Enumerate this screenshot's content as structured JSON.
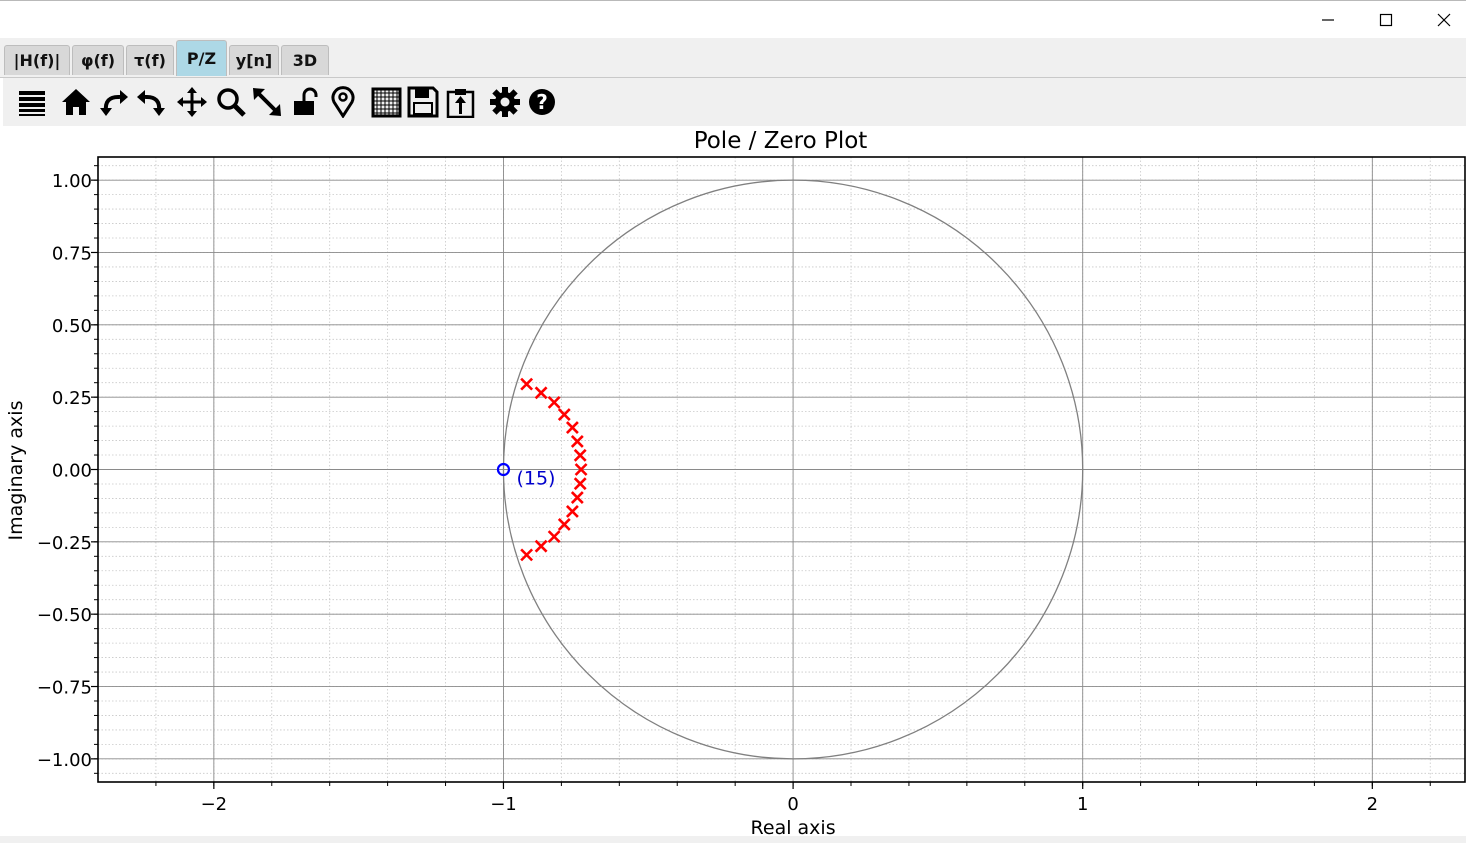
{
  "window": {
    "controls": [
      "minimize",
      "maximize",
      "close"
    ]
  },
  "tabs": [
    {
      "label": "|H(f)|",
      "active": false
    },
    {
      "label": "φ(f)",
      "active": false
    },
    {
      "label": "τ(f)",
      "active": false
    },
    {
      "label": "P/Z",
      "active": true
    },
    {
      "label": "y[n]",
      "active": false
    },
    {
      "label": "3D",
      "active": false
    }
  ],
  "toolbar": {
    "icons": [
      "menu-icon",
      "home-icon",
      "undo-icon",
      "redo-icon",
      "pan-icon",
      "zoom-icon",
      "autoscale-icon",
      "lock-icon",
      "marker-icon",
      "grid-icon",
      "save-icon",
      "clipboard-icon",
      "settings-icon",
      "help-icon"
    ]
  },
  "colors": {
    "active_tab": "#add8e6",
    "poles": "#ff0000",
    "zeros": "#0000ff",
    "unit_circle": "#808080"
  },
  "chart_data": {
    "type": "scatter",
    "title": "Pole / Zero Plot",
    "xlabel": "Real axis",
    "ylabel": "Imaginary axis",
    "xlim": [
      -2.4,
      2.32
    ],
    "ylim": [
      -1.08,
      1.08
    ],
    "xticks": [
      -2,
      -1,
      0,
      1,
      2
    ],
    "xtick_labels": [
      "−2",
      "−1",
      "0",
      "1",
      "2"
    ],
    "yticks": [
      1.0,
      0.75,
      0.5,
      0.25,
      0.0,
      -0.25,
      -0.5,
      -0.75,
      -1.0
    ],
    "ytick_labels": [
      "1.00",
      "0.75",
      "0.50",
      "0.25",
      "0.00",
      "−0.25",
      "−0.50",
      "−0.75",
      "−1.00"
    ],
    "grid": true,
    "minor_grid": true,
    "unit_circle": true,
    "series": [
      {
        "marker": "x",
        "color": "#ff0000",
        "points": [
          {
            "x": -0.92,
            "y": 0.295
          },
          {
            "x": -0.87,
            "y": 0.265
          },
          {
            "x": -0.825,
            "y": 0.232
          },
          {
            "x": -0.79,
            "y": 0.19
          },
          {
            "x": -0.762,
            "y": 0.145
          },
          {
            "x": -0.745,
            "y": 0.097
          },
          {
            "x": -0.735,
            "y": 0.049
          },
          {
            "x": -0.732,
            "y": 0.0
          },
          {
            "x": -0.735,
            "y": -0.049
          },
          {
            "x": -0.745,
            "y": -0.097
          },
          {
            "x": -0.762,
            "y": -0.145
          },
          {
            "x": -0.79,
            "y": -0.19
          },
          {
            "x": -0.825,
            "y": -0.232
          },
          {
            "x": -0.87,
            "y": -0.265
          },
          {
            "x": -0.92,
            "y": -0.295
          }
        ]
      },
      {
        "marker": "o",
        "color": "#0000ff",
        "points": [
          {
            "x": -1.0,
            "y": 0.0
          }
        ]
      }
    ],
    "annotations": [
      {
        "text": "(15)",
        "x": -1.0,
        "y": 0.0
      }
    ]
  }
}
